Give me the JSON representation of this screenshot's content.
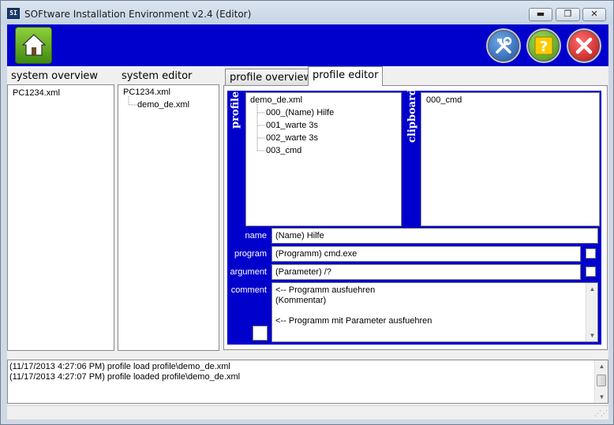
{
  "window": {
    "title": "SOFtware Installation Environment v2.4 (Editor)",
    "icon_label": "SI",
    "minimize_label": "▬",
    "maximize_label": "❐",
    "close_label": "✕"
  },
  "toolbar": {
    "home_icon": "home-icon",
    "tools_icon": "tools-icon",
    "help_icon": "help-icon",
    "exit_icon": "exit-icon",
    "colors": {
      "background": "#0000cc",
      "home": "#5faa22",
      "tools": "#2a64b8",
      "help": "#5db42c",
      "exit": "#d41b1b"
    }
  },
  "panels": {
    "system_overview": {
      "label": "system overview",
      "items": [
        "PC1234.xml"
      ]
    },
    "system_editor": {
      "label": "system editor",
      "root": "PC1234.xml",
      "children": [
        "demo_de.xml"
      ]
    }
  },
  "tabs": {
    "profile_overview": "profile overview",
    "profile_editor": "profile editor"
  },
  "profile_editor": {
    "profile_label": "profile",
    "clipboard_label": "clipboard",
    "profile_tree": {
      "root": "demo_de.xml",
      "children": [
        "000_(Name) Hilfe",
        "001_warte 3s",
        "002_warte 3s",
        "003_cmd"
      ]
    },
    "clipboard_items": [
      "000_cmd"
    ],
    "fields": {
      "name_label": "name",
      "name_value": "(Name) Hilfe",
      "program_label": "program",
      "program_value": "(Programm) cmd.exe",
      "argument_label": "argument",
      "argument_value": "(Parameter) /?",
      "comment_label": "comment",
      "comment_lines": [
        "<-- Programm ausfuehren",
        "(Kommentar)",
        "",
        "<-- Programm mit Parameter ausfuehren"
      ]
    }
  },
  "log": {
    "lines": [
      "(11/17/2013 4:27:06 PM) profile load profile\\demo_de.xml",
      "(11/17/2013 4:27:07 PM) profile loaded profile\\demo_de.xml"
    ]
  }
}
